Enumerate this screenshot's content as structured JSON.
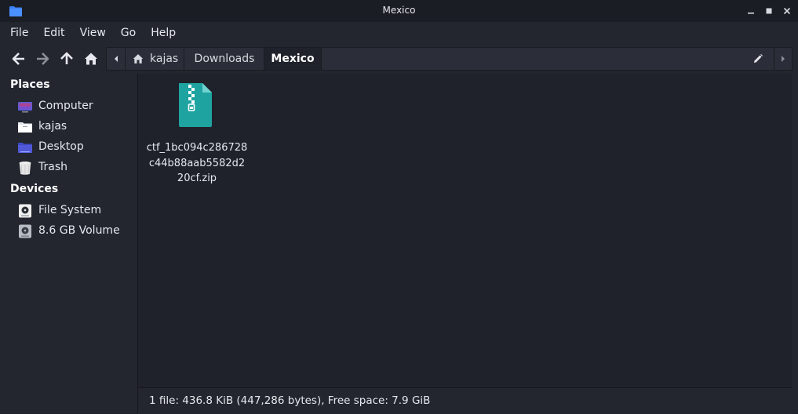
{
  "window": {
    "title": "Mexico",
    "minimize_glyph": "_",
    "maximize_glyph": "■",
    "close_glyph": "✕"
  },
  "menubar": {
    "items": [
      "File",
      "Edit",
      "View",
      "Go",
      "Help"
    ]
  },
  "toolbar": {
    "back_icon": "arrow-left-icon",
    "forward_icon": "arrow-right-icon",
    "up_icon": "arrow-up-icon",
    "home_icon": "home-icon"
  },
  "pathbar": {
    "crumbs": [
      {
        "label": "kajas",
        "icon": "home-icon"
      },
      {
        "label": "Downloads"
      },
      {
        "label": "Mexico",
        "active": true
      }
    ]
  },
  "sidebar": {
    "places_header": "Places",
    "places": [
      {
        "label": "Computer",
        "icon": "computer-icon"
      },
      {
        "label": "kajas",
        "icon": "home-folder-icon"
      },
      {
        "label": "Desktop",
        "icon": "desktop-icon"
      },
      {
        "label": "Trash",
        "icon": "trash-icon"
      }
    ],
    "devices_header": "Devices",
    "devices": [
      {
        "label": "File System",
        "icon": "drive-icon"
      },
      {
        "label": "8.6 GB Volume",
        "icon": "drive-icon"
      }
    ]
  },
  "files": [
    {
      "name": "ctf_1bc094c286728c44b88aab5582d220cf.zip",
      "icon": "zip-archive-icon",
      "icon_color": "#1fa3a0"
    }
  ],
  "status": {
    "text": "1 file: 436.8 KiB (447,286 bytes), Free space: 7.9 GiB"
  },
  "colors": {
    "accent": "#3b82f6",
    "archive": "#1fa3a0",
    "background": "#1f222b"
  }
}
